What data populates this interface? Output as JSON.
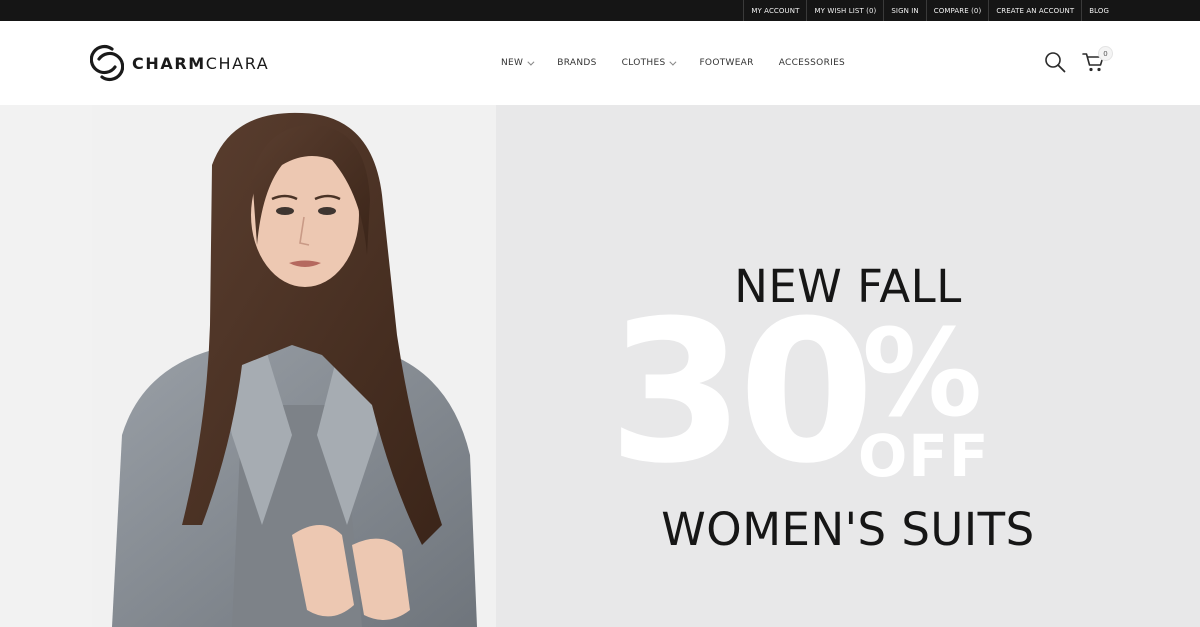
{
  "topbar": {
    "links": [
      "MY ACCOUNT",
      "MY WISH LIST (0)",
      "SIGN IN",
      "COMPARE (0)",
      "CREATE AN ACCOUNT",
      "BLOG"
    ]
  },
  "header": {
    "logo_bold": "CHARM",
    "logo_light": "CHARA",
    "nav": [
      {
        "label": "NEW",
        "has_dropdown": true
      },
      {
        "label": "BRANDS",
        "has_dropdown": false
      },
      {
        "label": "CLOTHES",
        "has_dropdown": true
      },
      {
        "label": "FOOTWEAR",
        "has_dropdown": false
      },
      {
        "label": "ACCESSORIES",
        "has_dropdown": false
      }
    ],
    "icons": {
      "search": "search-icon",
      "cart": "cart-icon"
    },
    "cart_count": "0"
  },
  "hero": {
    "headline": "NEW FALL",
    "discount": "30",
    "percent": "%",
    "off": "OFF",
    "subline": "WOMEN'S SUITS"
  },
  "colors": {
    "topbar_bg": "#151515",
    "hero_right_bg": "#e8e8e9",
    "text_dark": "#161616"
  }
}
